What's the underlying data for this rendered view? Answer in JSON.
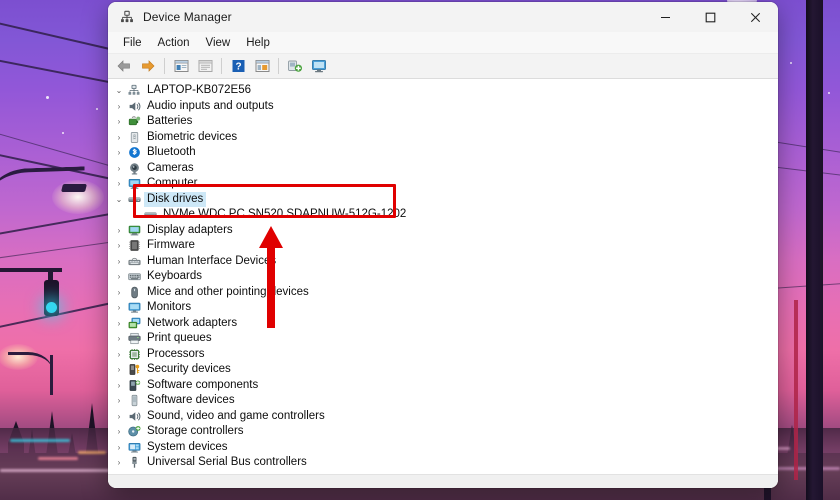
{
  "window": {
    "title": "Device Manager",
    "title_icon": "device-manager-icon",
    "controls": {
      "minimize": "–",
      "maximize": "□",
      "close": "✕"
    }
  },
  "menubar": {
    "items": [
      {
        "label": "File",
        "name": "menu-file"
      },
      {
        "label": "Action",
        "name": "menu-action"
      },
      {
        "label": "View",
        "name": "menu-view"
      },
      {
        "label": "Help",
        "name": "menu-help"
      }
    ]
  },
  "toolbar": {
    "buttons": [
      {
        "name": "back-button",
        "icon": "arrow-left-icon",
        "title": "Back"
      },
      {
        "name": "forward-button",
        "icon": "arrow-right-icon",
        "title": "Forward"
      },
      {
        "name": "show-hide-console-tree-button",
        "icon": "console-tree-icon",
        "title": "Show/Hide Console Tree"
      },
      {
        "name": "properties-button",
        "icon": "properties-icon",
        "title": "Properties"
      },
      {
        "name": "help-button",
        "icon": "help-question-icon",
        "title": "Help"
      },
      {
        "name": "update-driver-button",
        "icon": "update-driver-icon",
        "title": "Update driver"
      },
      {
        "name": "scan-hardware-changes-button",
        "icon": "scan-hardware-icon",
        "title": "Scan for hardware changes"
      },
      {
        "name": "display-device-button",
        "icon": "monitor-icon",
        "title": "Display device"
      }
    ]
  },
  "tree": {
    "root": {
      "label": "LAPTOP-KB072E56",
      "icon": "computer-root-icon",
      "expanded": true,
      "chevron": "⌄"
    },
    "items": [
      {
        "label": "Audio inputs and outputs",
        "icon": "speaker-icon",
        "indent": 1,
        "expanded": false,
        "selected": false
      },
      {
        "label": "Batteries",
        "icon": "battery-icon",
        "indent": 1,
        "expanded": false,
        "selected": false
      },
      {
        "label": "Biometric devices",
        "icon": "fingerprint-icon",
        "indent": 1,
        "expanded": false,
        "selected": false
      },
      {
        "label": "Bluetooth",
        "icon": "bluetooth-icon",
        "indent": 1,
        "expanded": false,
        "selected": false
      },
      {
        "label": "Cameras",
        "icon": "camera-icon",
        "indent": 1,
        "expanded": false,
        "selected": false
      },
      {
        "label": "Computer",
        "icon": "computer-icon",
        "indent": 1,
        "expanded": false,
        "selected": false
      },
      {
        "label": "Disk drives",
        "icon": "disk-drive-icon",
        "indent": 1,
        "expanded": true,
        "selected": true
      },
      {
        "label": "NVMe WDC PC SN520 SDAPNUW-512G-1202",
        "icon": "disk-drive-icon",
        "indent": 2,
        "expanded": null,
        "selected": false
      },
      {
        "label": "Display adapters",
        "icon": "display-adapter-icon",
        "indent": 1,
        "expanded": false,
        "selected": false
      },
      {
        "label": "Firmware",
        "icon": "firmware-icon",
        "indent": 1,
        "expanded": false,
        "selected": false
      },
      {
        "label": "Human Interface Devices",
        "icon": "hid-icon",
        "indent": 1,
        "expanded": false,
        "selected": false
      },
      {
        "label": "Keyboards",
        "icon": "keyboard-icon",
        "indent": 1,
        "expanded": false,
        "selected": false
      },
      {
        "label": "Mice and other pointing devices",
        "icon": "mouse-icon",
        "indent": 1,
        "expanded": false,
        "selected": false
      },
      {
        "label": "Monitors",
        "icon": "monitor-icon",
        "indent": 1,
        "expanded": false,
        "selected": false
      },
      {
        "label": "Network adapters",
        "icon": "network-adapter-icon",
        "indent": 1,
        "expanded": false,
        "selected": false
      },
      {
        "label": "Print queues",
        "icon": "printer-icon",
        "indent": 1,
        "expanded": false,
        "selected": false
      },
      {
        "label": "Processors",
        "icon": "processor-icon",
        "indent": 1,
        "expanded": false,
        "selected": false
      },
      {
        "label": "Security devices",
        "icon": "security-device-icon",
        "indent": 1,
        "expanded": false,
        "selected": false
      },
      {
        "label": "Software components",
        "icon": "software-component-icon",
        "indent": 1,
        "expanded": false,
        "selected": false
      },
      {
        "label": "Software devices",
        "icon": "software-device-icon",
        "indent": 1,
        "expanded": false,
        "selected": false
      },
      {
        "label": "Sound, video and game controllers",
        "icon": "speaker-icon",
        "indent": 1,
        "expanded": false,
        "selected": false
      },
      {
        "label": "Storage controllers",
        "icon": "storage-controller-icon",
        "indent": 1,
        "expanded": false,
        "selected": false
      },
      {
        "label": "System devices",
        "icon": "system-device-icon",
        "indent": 1,
        "expanded": false,
        "selected": false
      },
      {
        "label": "Universal Serial Bus controllers",
        "icon": "usb-icon",
        "indent": 1,
        "expanded": false,
        "selected": false
      }
    ],
    "chevron_collapsed": "›",
    "chevron_expanded": "⌄"
  },
  "annotations": {
    "highlight_box": {
      "name": "red-highlight-box",
      "color": "#e00000"
    },
    "arrow": {
      "name": "red-up-arrow",
      "color": "#e00000",
      "direction": "up"
    }
  },
  "statusbar": {
    "text": ""
  },
  "colors": {
    "selection": "#cde8f7",
    "titlebar": "#f3f3f3",
    "annotation": "#e00000",
    "wallpaper_top": "#7c4fd0",
    "wallpaper_mid": "#e86fb4",
    "wallpaper_bottom": "#36243f"
  }
}
